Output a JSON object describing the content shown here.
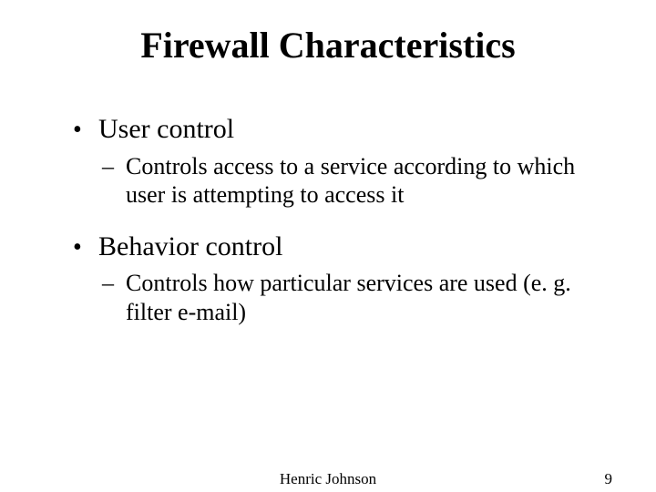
{
  "title": "Firewall Characteristics",
  "bullets": {
    "b1": {
      "label": "User control",
      "sub": "Controls access to a service according to which user is attempting to access it"
    },
    "b2": {
      "label": "Behavior control",
      "sub": "Controls how particular services are used (e. g. filter e-mail)"
    }
  },
  "footer": {
    "author": "Henric Johnson",
    "page": "9"
  }
}
